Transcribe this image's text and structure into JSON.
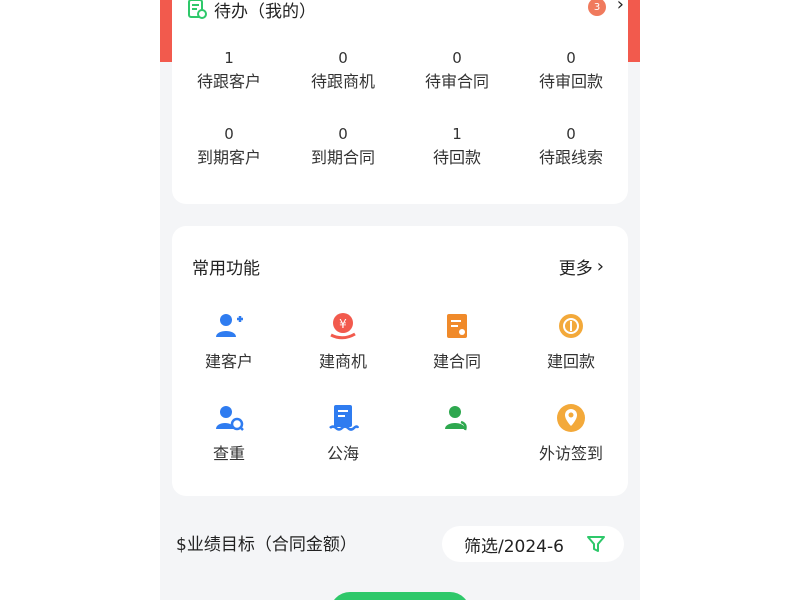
{
  "todo": {
    "title": "待办（我的）",
    "badge": "3",
    "stats": [
      {
        "value": "1",
        "label": "待跟客户"
      },
      {
        "value": "0",
        "label": "待跟商机"
      },
      {
        "value": "0",
        "label": "待审合同"
      },
      {
        "value": "0",
        "label": "待审回款"
      },
      {
        "value": "0",
        "label": "到期客户"
      },
      {
        "value": "0",
        "label": "到期合同"
      },
      {
        "value": "1",
        "label": "待回款"
      },
      {
        "value": "0",
        "label": "待跟线索"
      }
    ]
  },
  "functions": {
    "title": "常用功能",
    "more_label": "更多",
    "items": [
      {
        "label": "建客户",
        "icon": "add-customer-icon"
      },
      {
        "label": "建商机",
        "icon": "opportunity-icon"
      },
      {
        "label": "建合同",
        "icon": "contract-icon"
      },
      {
        "label": "建回款",
        "icon": "payment-icon"
      },
      {
        "label": "查重",
        "icon": "duplicate-check-icon"
      },
      {
        "label": "公海",
        "icon": "public-pool-icon"
      },
      {
        "label": "",
        "icon": "contact-icon"
      },
      {
        "label": "外访签到",
        "icon": "location-pin-icon"
      }
    ]
  },
  "performance": {
    "title": "$业绩目标（合同金额）",
    "filter_label": "筛选/2024-6"
  },
  "colors": {
    "accent_green": "#2ec86a",
    "blue_icon": "#2f7cf0",
    "red_icon": "#f25a4d",
    "orange_icon": "#f08a2a",
    "yellow_icon": "#f3a93a"
  }
}
